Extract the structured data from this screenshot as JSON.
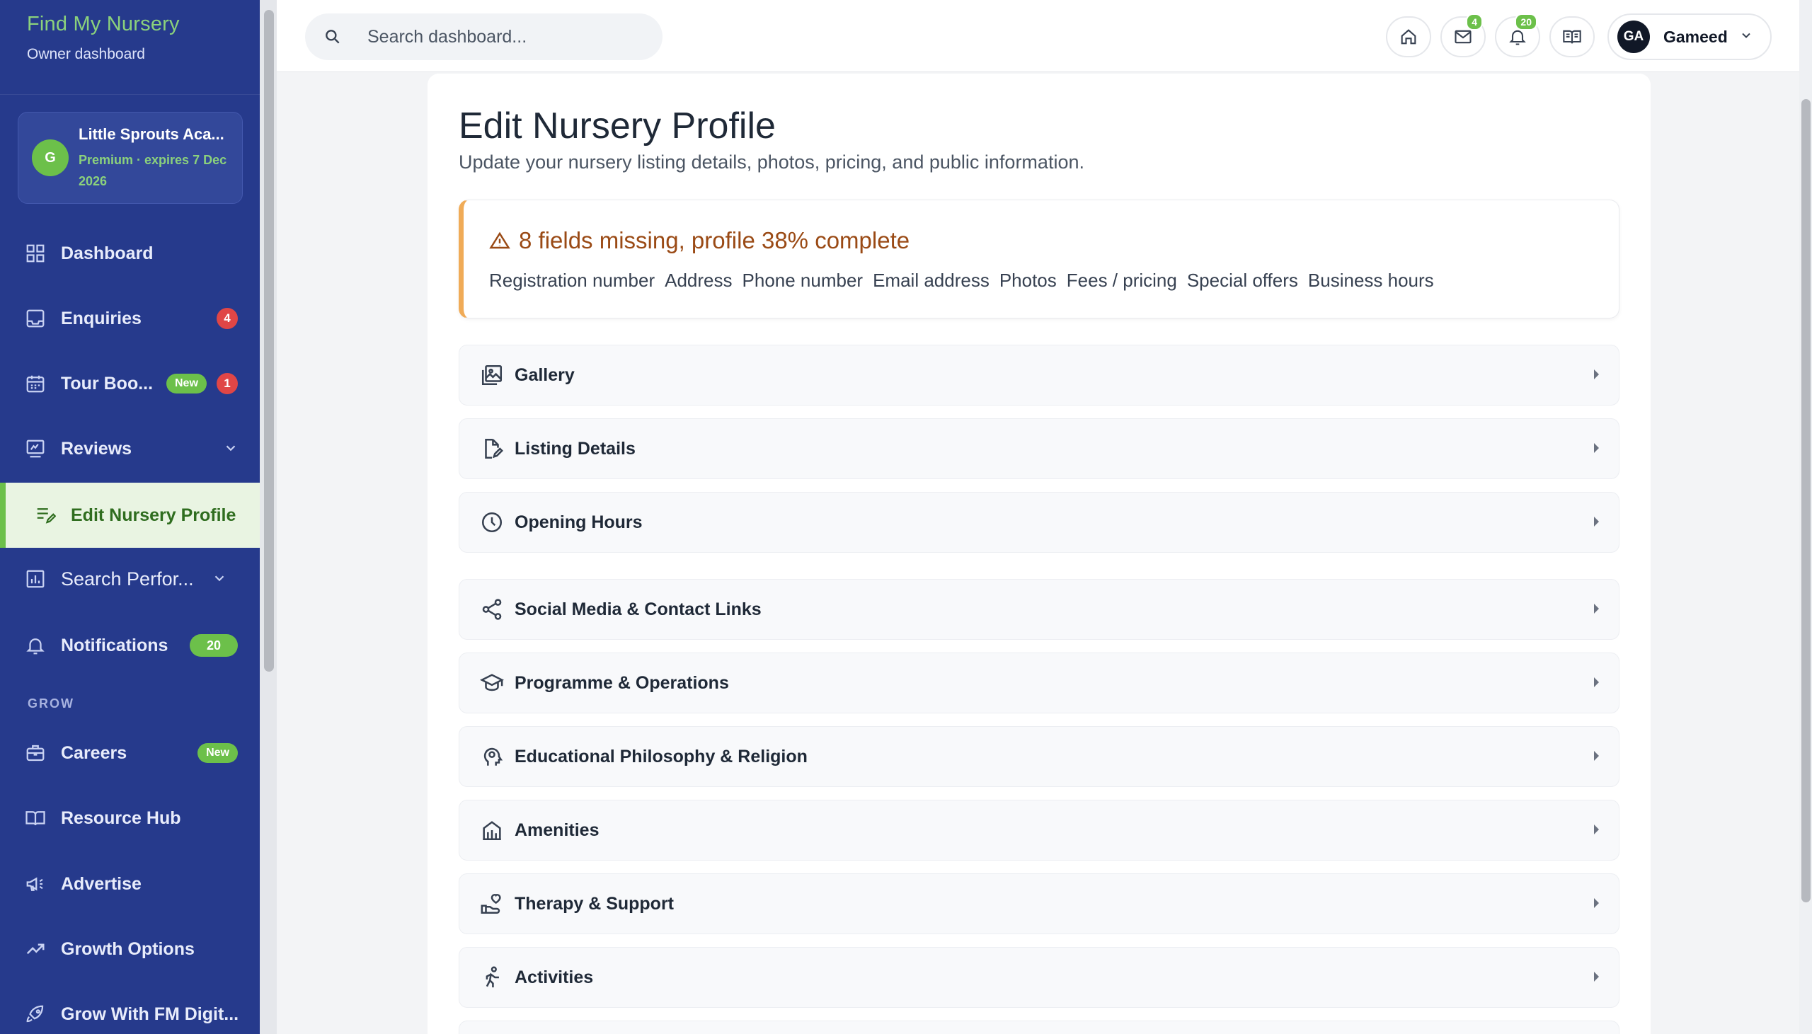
{
  "brand": {
    "title": "Find My Nursery",
    "subtitle": "Owner dashboard"
  },
  "account": {
    "initial": "G",
    "name": "Little Sprouts Aca...",
    "plan": "Premium · expires 7 Dec 2026"
  },
  "sidebar": {
    "items": [
      {
        "label": "Dashboard",
        "icon": "dashboard-icon"
      },
      {
        "label": "Enquiries",
        "icon": "inbox-icon",
        "badge": "4"
      },
      {
        "label": "Tour Boo...",
        "icon": "calendar-icon",
        "tag": "New",
        "badge": "1"
      },
      {
        "label": "Reviews",
        "icon": "reviews-icon"
      },
      {
        "label": "Edit Nursery Profile",
        "icon": "edit-list-icon",
        "active": true
      },
      {
        "label": "Search Perfor...",
        "icon": "chart-icon"
      },
      {
        "label": "Notifications",
        "icon": "bell-icon",
        "badge": "20"
      }
    ],
    "group_label": "GROW",
    "grow_items": [
      {
        "label": "Careers",
        "icon": "briefcase-icon",
        "tag": "New"
      },
      {
        "label": "Resource Hub",
        "icon": "book-icon"
      },
      {
        "label": "Advertise",
        "icon": "megaphone-icon"
      },
      {
        "label": "Growth Options",
        "icon": "trend-up-icon"
      },
      {
        "label": "Grow With FM Digit...",
        "icon": "rocket-icon"
      }
    ]
  },
  "topbar": {
    "search_placeholder": "Search dashboard...",
    "mail_badge": "4",
    "bell_badge": "20",
    "user_initials": "GA",
    "user_name": "Gameed"
  },
  "page": {
    "title": "Edit Nursery Profile",
    "subtitle": "Update your nursery listing details, photos, pricing, and public information."
  },
  "alert": {
    "title": "8 fields missing, profile 38% complete",
    "missing": [
      "Registration number",
      "Address",
      "Phone number",
      "Email address",
      "Photos",
      "Fees / pricing",
      "Special offers",
      "Business hours"
    ]
  },
  "sections": [
    {
      "label": "Gallery",
      "icon": "gallery-icon"
    },
    {
      "label": "Listing Details",
      "icon": "document-edit-icon"
    },
    {
      "label": "Opening Hours",
      "icon": "clock-icon"
    },
    {
      "label": "Social Media & Contact Links",
      "icon": "share-icon"
    },
    {
      "label": "Programme & Operations",
      "icon": "graduation-cap-icon"
    },
    {
      "label": "Educational Philosophy & Religion",
      "icon": "head-idea-icon"
    },
    {
      "label": "Amenities",
      "icon": "building-icon"
    },
    {
      "label": "Therapy & Support",
      "icon": "hand-heart-icon"
    },
    {
      "label": "Activities",
      "icon": "running-icon"
    }
  ],
  "colors": {
    "sidebar": "#263a8c",
    "accent_green": "#6cc04a",
    "alert_border": "#f0ab57",
    "badge_red": "#e04646"
  }
}
